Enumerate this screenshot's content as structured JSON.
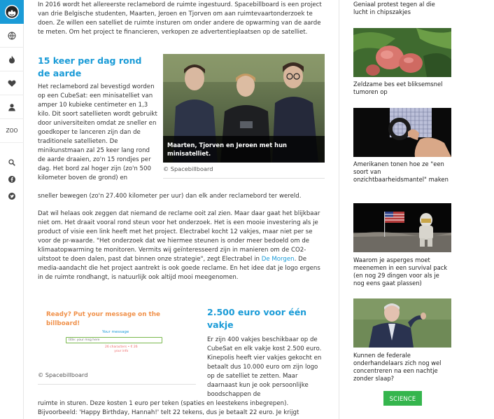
{
  "rail": {
    "zoo_label": "ZOO"
  },
  "article": {
    "intro": "In 2016 wordt het allereerste reclamebord de ruimte ingestuurd. Spacebillboard is een project van drie Belgische studenten, Maarten, Jeroen en Tjorven om aan ruimtevaartonderzoek te doen. Ze willen een satelliet de ruimte insturen om onder andere de opwarming van de aarde te meten. Om het project te financieren, verkopen ze advertentieplaatsen op de satelliet.",
    "heading1": "15 keer per dag rond de aarde",
    "para1_float": "Het reclamebord zal bevestigd worden op een CubeSat: een minisatelliet van amper 10 kubieke centimeter en 1,3 kilo. Dit soort satellieten wordt gebruikt door universiteiten omdat ze sneller en goedkoper te lanceren zijn dan de traditionele satellieten. De minikunstmaan zal 25 keer lang rond de aarde draaien, zo'n 15 rondjes per dag. Het bord zal hoger zijn (zo'n 500 kilometer boven de grond) en",
    "para1_full": "sneller bewegen (zo'n 27.400 kilometer per uur) dan elk ander reclamebord ter wereld.",
    "figure1_caption": "Maarten, Tjorven en Jeroen met hun minisatelliet.",
    "figure1_credit": "© Spacebillboard",
    "para2_before_link": "Dat wil helaas ook zeggen dat niemand de reclame ooit zal zien. Maar daar gaat het blijkbaar niet om. Het draait vooral rond steun voor het onderzoek. Het is een mooie investering als je product of visie een link heeft met het project. Electrabel kocht 12 vakjes, maar niet per se voor de pr-waarde. \"Het onderzoek dat we hiermee steunen is onder meer bedoeld om de klimaatopwarming te monitoren. Vermits wij geïnteresseerd zijn in manieren om de CO2-uitstoot te doen dalen, past dat binnen onze strategie\", zegt Electrabel in ",
    "para2_link": "De Morgen",
    "para2_after_link": ". De media-aandacht die het project aantrekt is ook goede reclame. En het idee dat je logo ergens in de ruimte rondhangt, is natuurlijk ook altijd mooi meegenomen.",
    "heading2": "2.500 euro voor één vakje",
    "para3_float": "Er zijn 400 vakjes beschikbaar op de CubeSat en elk vakje kost 2.500 euro. Kinepolis heeft vier vakjes gekocht en betaalt dus 10.000 euro om zijn logo op de satelliet te zetten. Maar daarnaast kun je ook persoonlijke boodschappen de",
    "para3_full": "ruimte in sturen. Deze kosten 1 euro per teken (spaties en leestekens inbegrepen). Bijvoorbeeld: 'Happy Birthday, Hannah!' telt 22 tekens, dus je betaalt 22 euro. Je krijgt",
    "figure2_title": "Ready? Put your message on the billboard!",
    "figure2_label": "Your message",
    "figure2_input": "title: your msg here",
    "figure2_small_1": "26 characters • € 26",
    "figure2_small_2": "your info",
    "figure2_credit": "© Spacebillboard"
  },
  "sidebar": {
    "items": [
      {
        "title": "Geniaal protest tegen al die lucht in chipszakjes"
      },
      {
        "title": "Zeldzame bes eet bliksemsnel tumoren op"
      },
      {
        "title": "Amerikanen tonen hoe ze \"een soort van onzichtbaarheidsmantel\" maken"
      },
      {
        "title": "Waarom je asperges moet meenemen in een survival pack (en nog 29 dingen voor als je nog eens gaat plassen)"
      },
      {
        "title": "Kunnen de federale onderhandelaars zich nog wel concentreren na een nachtje zonder slaap?"
      }
    ],
    "science_label": "SCIENCE"
  },
  "colors": {
    "accent": "#1a9bd7",
    "science": "#35b54d"
  },
  "icons": [
    "monkey-logo-icon",
    "globe-icon",
    "flame-icon",
    "heart-icon",
    "user-icon",
    "search-icon",
    "facebook-icon",
    "twitter-icon"
  ]
}
